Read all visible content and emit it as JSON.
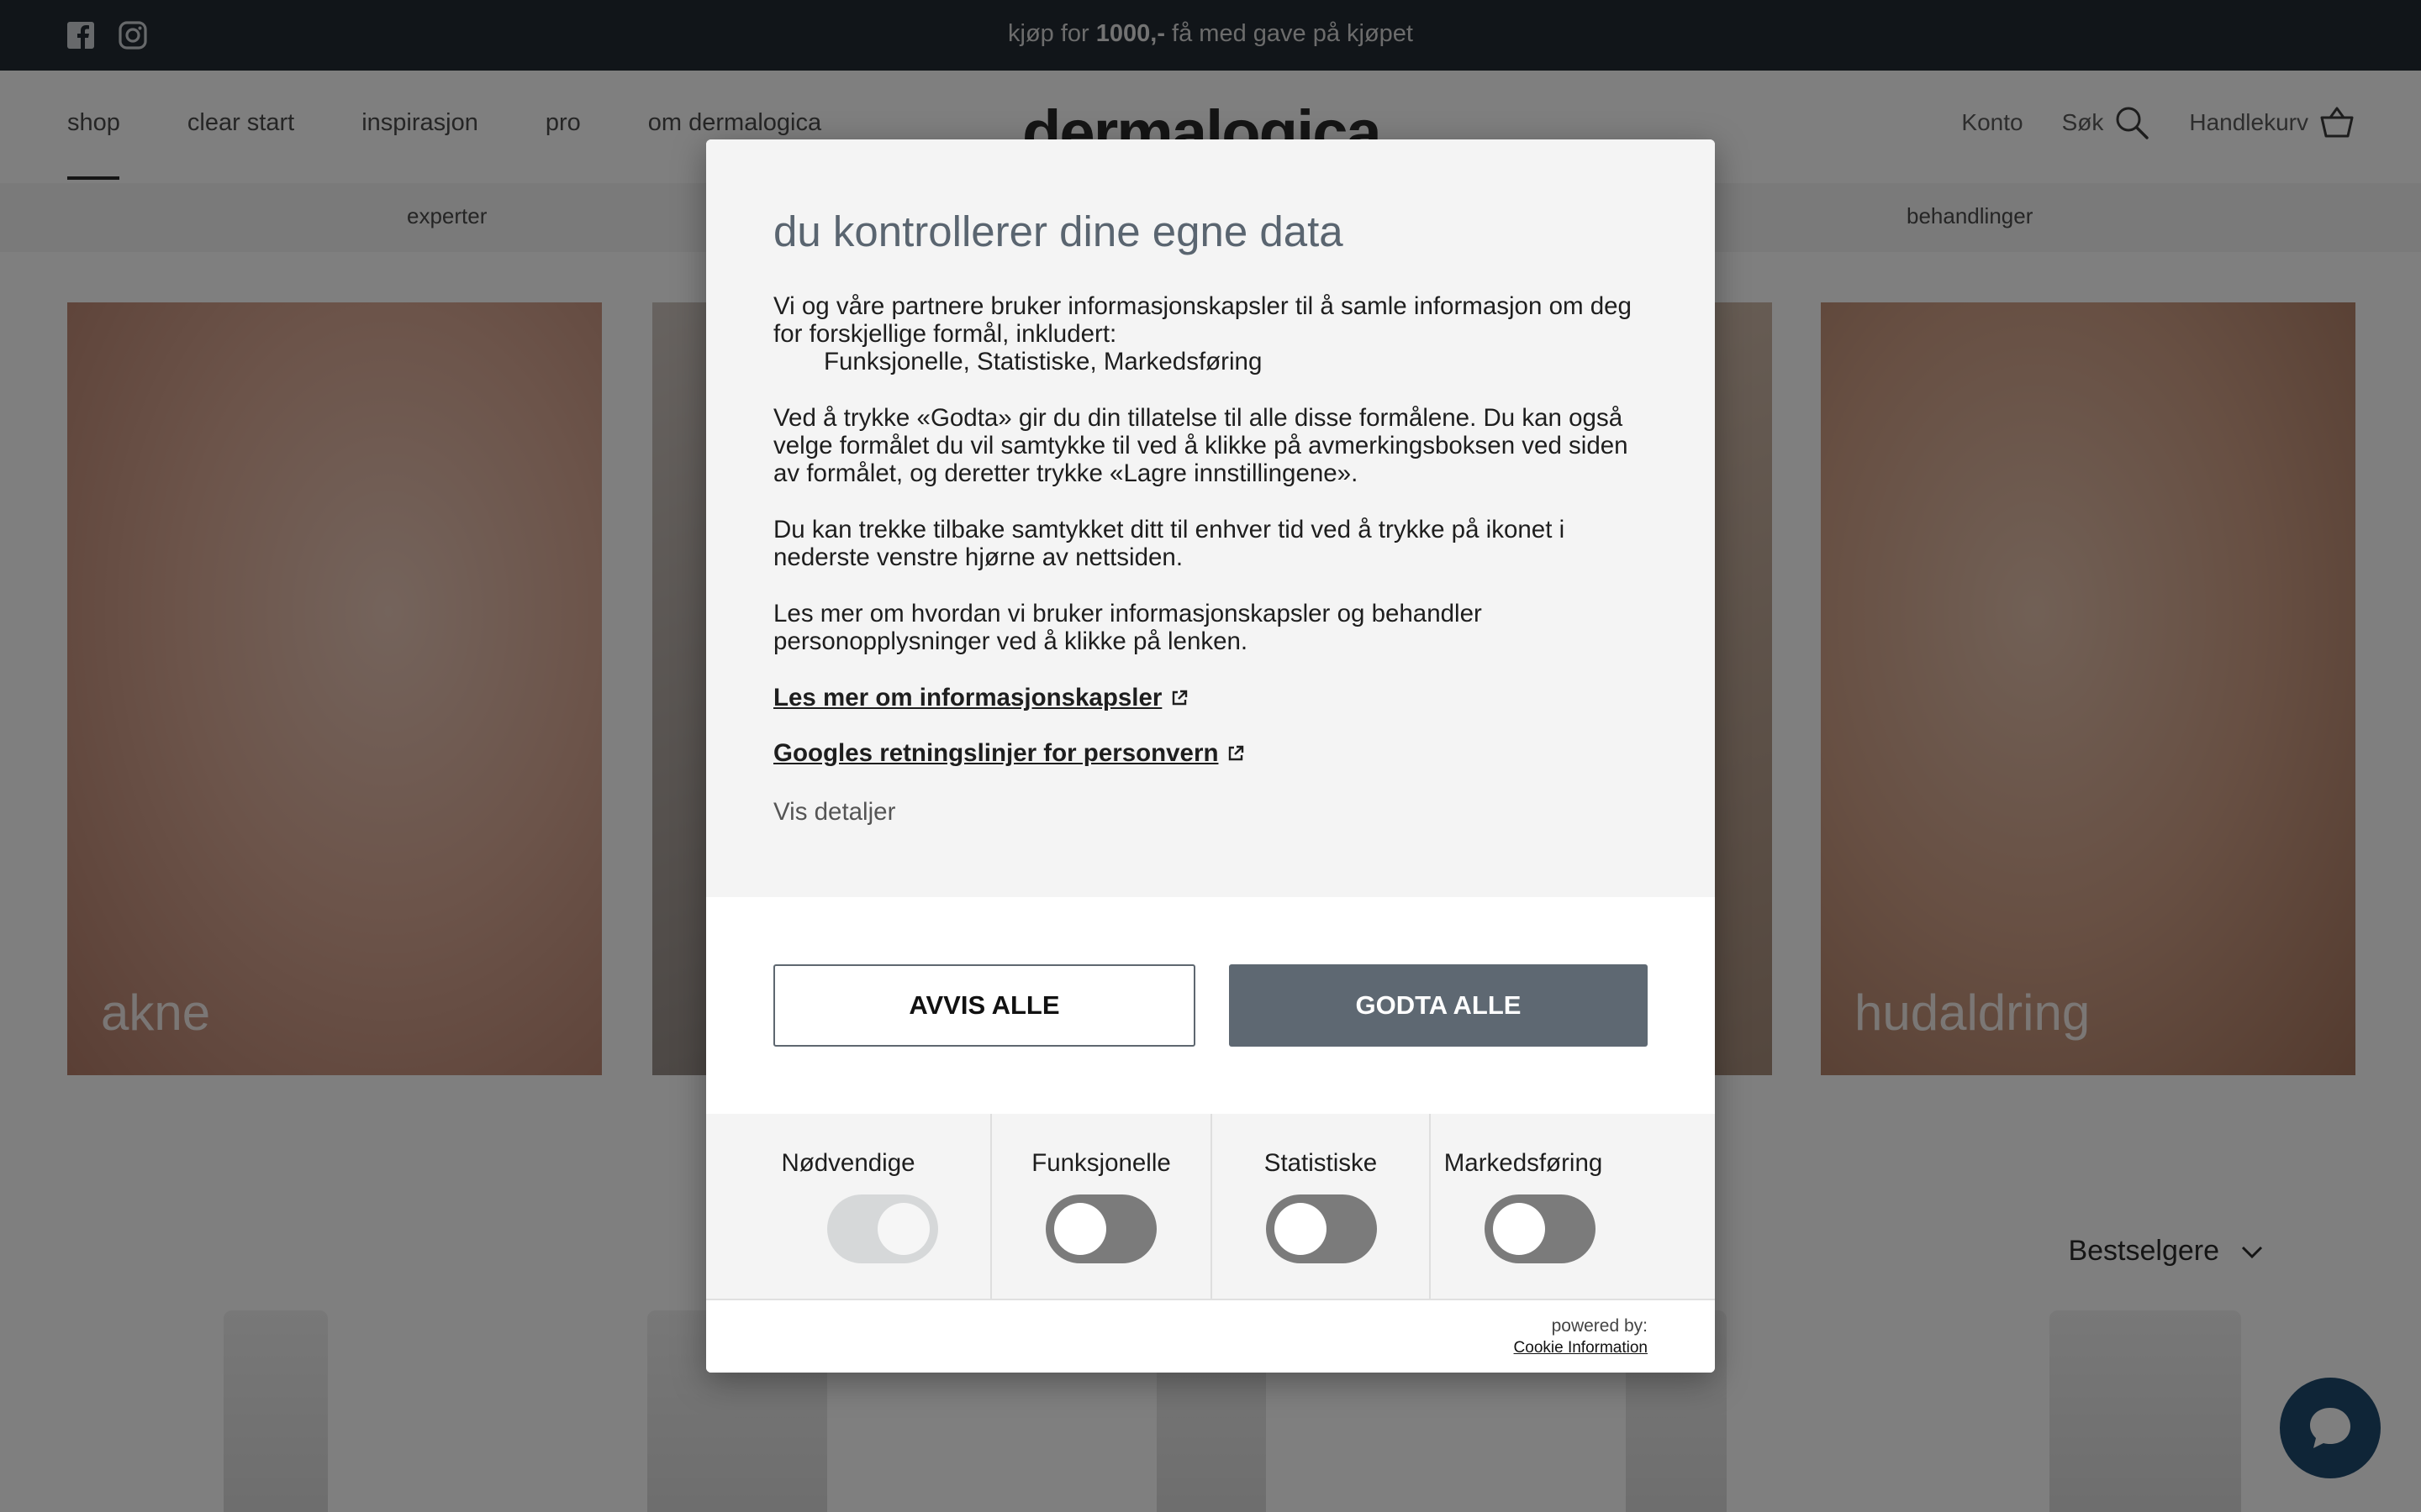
{
  "topbar": {
    "promo_prefix": "kjøp for ",
    "promo_amount": "1000,-",
    "promo_suffix": " få med gave på kjøpet",
    "icons": [
      "facebook-icon",
      "instagram-icon"
    ]
  },
  "header": {
    "nav": [
      "shop",
      "clear start",
      "inspirasjon",
      "pro",
      "om dermalogica"
    ],
    "logo": "dermalogica",
    "account": "Konto",
    "search": "Søk",
    "cart": "Handlekurv"
  },
  "subnav": {
    "left": "experter",
    "right": "behandlinger"
  },
  "tiles": [
    "akne",
    "hudaldring"
  ],
  "sort": {
    "label": "Bestselgere"
  },
  "cookie": {
    "title": "du kontrollerer dine egne data",
    "p1": "Vi og våre partnere bruker informasjonskapsler til å samle informasjon om deg for forskjellige formål, inkludert:",
    "p1_list": "Funksjonelle, Statistiske, Markedsføring",
    "p2": "Ved å trykke «Godta» gir du din tillatelse til alle disse formålene. Du kan også velge formålet du vil samtykke til ved å klikke på avmerkingsboksen ved siden av formålet, og deretter trykke «Lagre innstillingene».",
    "p3": "Du kan trekke tilbake samtykket ditt til enhver tid ved å trykke på ikonet i nederste venstre hjørne av nettsiden.",
    "p4": "Les mer om hvordan vi bruker informasjonskapsler og behandler personopplysninger ved å klikke på lenken.",
    "link1": "Les mer om informasjonskapsler",
    "link2": "Googles retningslinjer for personvern",
    "details": "Vis detaljer",
    "reject": "AVVIS ALLE",
    "accept": "GODTA ALLE",
    "toggles": [
      {
        "label": "Nødvendige",
        "state": "on-disabled"
      },
      {
        "label": "Funksjonelle",
        "state": "off"
      },
      {
        "label": "Statistiske",
        "state": "off"
      },
      {
        "label": "Markedsføring",
        "state": "off"
      }
    ],
    "powered_by": "powered by:",
    "provider": "Cookie Information"
  },
  "colors": {
    "topbar": "#232b33",
    "accept_button": "#5e6872",
    "chat": "#1f4a6f"
  }
}
